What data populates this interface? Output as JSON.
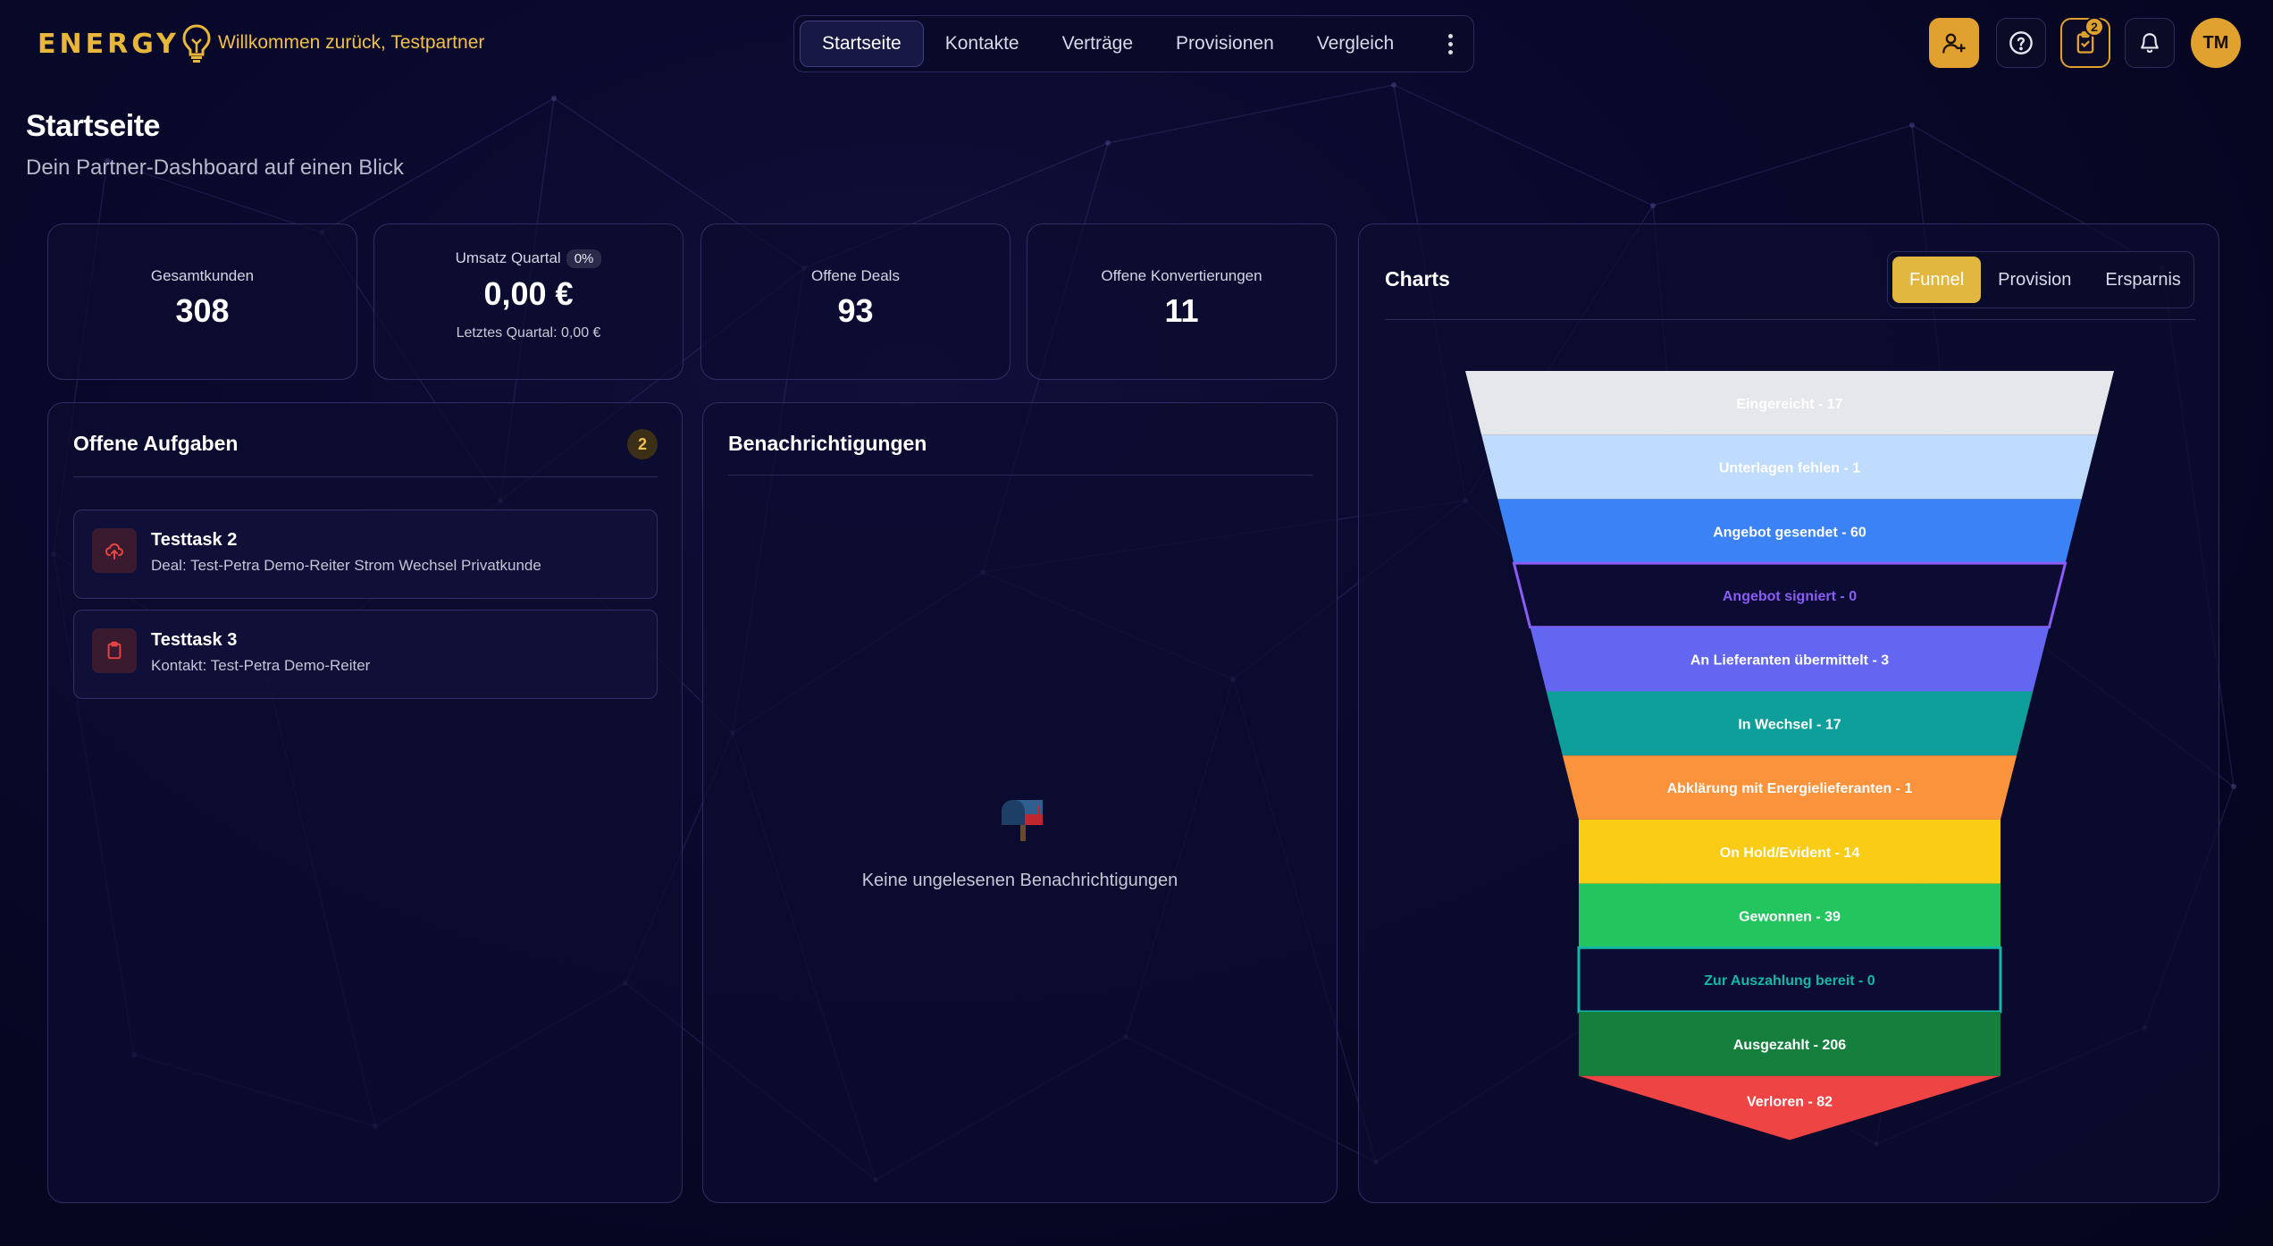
{
  "brand": {
    "logo_text": "ENERGY",
    "welcome": "Willkommen zurück, Testpartner",
    "accent": "#e1a12e"
  },
  "nav": {
    "tabs": [
      {
        "label": "Startseite",
        "active": true
      },
      {
        "label": "Kontakte"
      },
      {
        "label": "Verträge"
      },
      {
        "label": "Provisionen"
      },
      {
        "label": "Vergleich"
      }
    ]
  },
  "header_actions": {
    "icons": [
      "add-user-icon",
      "help-icon",
      "clipboard-check-icon",
      "bell-icon"
    ],
    "tasks_badge": "2",
    "avatar_initials": "TM"
  },
  "page": {
    "title": "Startseite",
    "subtitle": "Dein Partner-Dashboard auf einen Blick"
  },
  "stats": {
    "customers": {
      "label": "Gesamtkunden",
      "value": "308"
    },
    "revenue": {
      "label": "Umsatz Quartal",
      "pill": "0%",
      "value": "0,00 €",
      "footer": "Letztes Quartal: 0,00 €"
    },
    "deals": {
      "label": "Offene Deals",
      "value": "93"
    },
    "conversions": {
      "label": "Offene Konvertierungen",
      "value": "11"
    }
  },
  "tasks": {
    "title": "Offene Aufgaben",
    "count": "2",
    "items": [
      {
        "title": "Testtask 2",
        "subtitle": "Deal: Test-Petra Demo-Reiter Strom Wechsel Privatkunde",
        "icon": "upload-cloud-icon"
      },
      {
        "title": "Testtask 3",
        "subtitle": "Kontakt: Test-Petra Demo-Reiter",
        "icon": "clipboard-icon"
      }
    ]
  },
  "notifications": {
    "title": "Benachrichtigungen",
    "empty_text": "Keine ungelesenen Benachrichtigungen",
    "icon": "mailbox-icon"
  },
  "charts": {
    "title": "Charts",
    "tabs": [
      {
        "label": "Funnel",
        "active": true
      },
      {
        "label": "Provision"
      },
      {
        "label": "Ersparnis"
      }
    ]
  },
  "chart_data": {
    "type": "funnel",
    "stages": [
      {
        "label": "Eingereicht - 17",
        "name": "Eingereicht",
        "value": 17,
        "color": "#e5e7eb",
        "text_color": "#ffffff",
        "style": "filled"
      },
      {
        "label": "Unterlagen fehlen - 1",
        "name": "Unterlagen fehlen",
        "value": 1,
        "color": "#bfdbfe",
        "text_color": "#ffffff",
        "style": "filled"
      },
      {
        "label": "Angebot gesendet - 60",
        "name": "Angebot gesendet",
        "value": 60,
        "color": "#3b82f6",
        "text_color": "#ffffff",
        "style": "filled"
      },
      {
        "label": "Angebot signiert - 0",
        "name": "Angebot signiert",
        "value": 0,
        "color": "#8b5cf6",
        "text_color": "#8b5cf6",
        "style": "outline"
      },
      {
        "label": "An Lieferanten übermittelt - 3",
        "name": "An Lieferanten übermittelt",
        "value": 3,
        "color": "#6366f1",
        "text_color": "#ffffff",
        "style": "filled"
      },
      {
        "label": "In Wechsel - 17",
        "name": "In Wechsel",
        "value": 17,
        "color": "#0f9f9a",
        "text_color": "#ffffff",
        "style": "filled"
      },
      {
        "label": "Abklärung mit Energielieferanten - 1",
        "name": "Abklärung mit Energielieferanten",
        "value": 1,
        "color": "#fb923c",
        "text_color": "#ffffff",
        "style": "filled"
      },
      {
        "label": "On Hold/Evident - 14",
        "name": "On Hold/Evident",
        "value": 14,
        "color": "#facc15",
        "text_color": "#ffffff",
        "style": "filled"
      },
      {
        "label": "Gewonnen - 39",
        "name": "Gewonnen",
        "value": 39,
        "color": "#22c55e",
        "text_color": "#ffffff",
        "style": "filled"
      },
      {
        "label": "Zur Auszahlung bereit - 0",
        "name": "Zur Auszahlung bereit",
        "value": 0,
        "color": "#14b8a6",
        "text_color": "#14b8a6",
        "style": "outline"
      },
      {
        "label": "Ausgezahlt - 206",
        "name": "Ausgezahlt",
        "value": 206,
        "color": "#15803d",
        "text_color": "#ffffff",
        "style": "filled"
      },
      {
        "label": "Verloren - 82",
        "name": "Verloren",
        "value": 82,
        "color": "#ef4444",
        "text_color": "#ffffff",
        "style": "filled"
      }
    ]
  }
}
